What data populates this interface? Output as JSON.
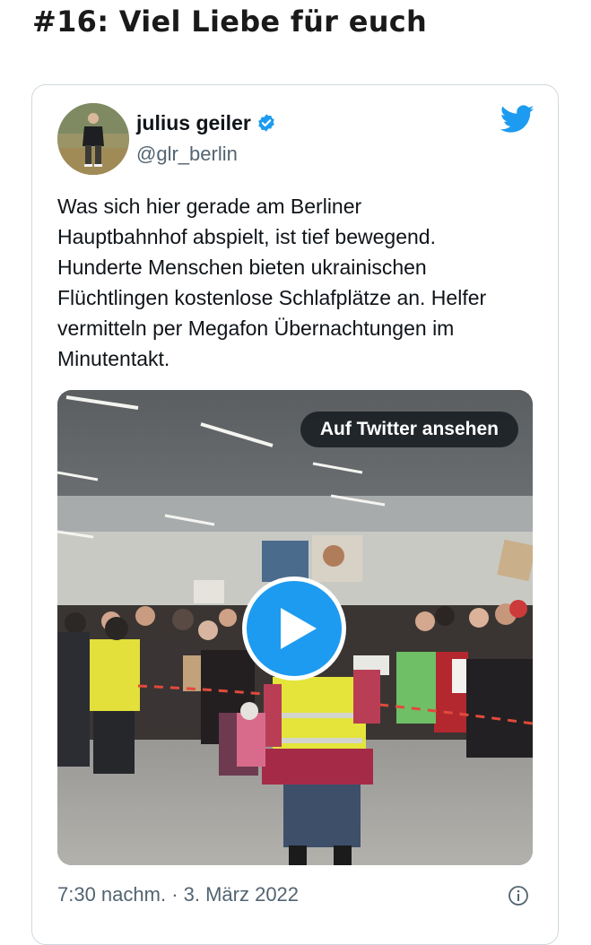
{
  "article": {
    "heading": "#16: Viel Liebe für euch"
  },
  "tweet": {
    "author_name": "julius geiler",
    "handle": "@glr_berlin",
    "text": "Was sich hier gerade am Berliner\nHauptbahnhof abspielt, ist tief bewegend.\nHunderte Menschen bieten ukrainischen\nFlüchtlingen kostenlose Schlafplätze an. Helfer\nvermitteln per Megafon Übernachtungen im\nMinutentakt.",
    "watch_label": "Auf Twitter ansehen",
    "timestamp": "7:30 nachm. · 3. März 2022",
    "icons": [
      "verified-badge-icon",
      "twitter-bird-icon",
      "play-icon",
      "info-icon"
    ]
  },
  "colors": {
    "twitter_blue": "#1d9bf0",
    "secondary_text": "#536471",
    "border": "#cfd9de"
  }
}
